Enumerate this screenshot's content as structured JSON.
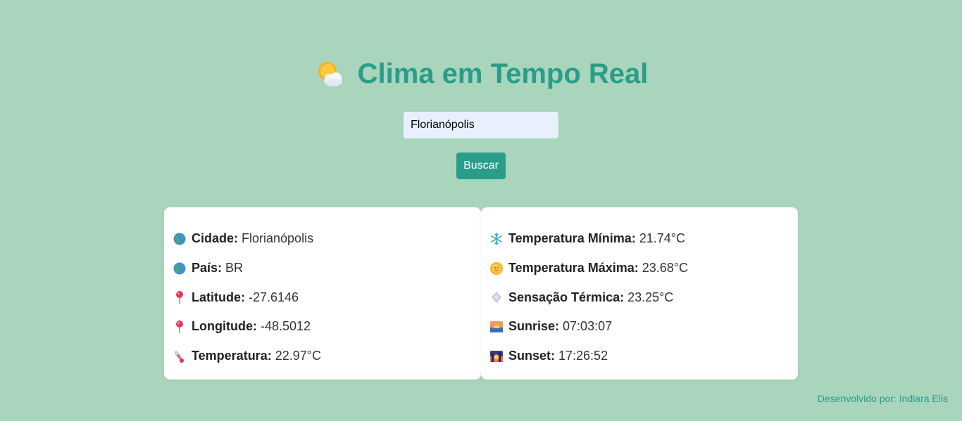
{
  "header": {
    "icon": "sun-behind-cloud-icon",
    "title": "Clima em Tempo Real"
  },
  "search": {
    "value": "Florianópolis",
    "button_label": "Buscar"
  },
  "left_card": [
    {
      "icon": "globe-icon",
      "label": "Cidade:",
      "value": "Florianópolis"
    },
    {
      "icon": "globe-icon",
      "label": "País:",
      "value": "BR"
    },
    {
      "icon": "pushpin-icon",
      "label": "Latitude:",
      "value": "-27.6146"
    },
    {
      "icon": "pushpin-icon",
      "label": "Longitude:",
      "value": "-48.5012"
    },
    {
      "icon": "thermometer-icon",
      "label": "Temperatura:",
      "value": "22.97°C"
    }
  ],
  "right_card": [
    {
      "icon": "snowflake-icon",
      "label": "Temperatura Mínima:",
      "value": "21.74°C"
    },
    {
      "icon": "sun-face-icon",
      "label": "Temperatura Máxima:",
      "value": "23.68°C"
    },
    {
      "icon": "wind-icon",
      "label": "Sensação Térmica:",
      "value": "23.25°C"
    },
    {
      "icon": "sunrise-icon",
      "label": "Sunrise:",
      "value": "07:03:07"
    },
    {
      "icon": "sunset-icon",
      "label": "Sunset:",
      "value": "17:26:52"
    }
  ],
  "footer": {
    "text": "Desenvolvido por: Indiara Elis"
  },
  "colors": {
    "background": "#a8d5bc",
    "accent": "#2a9d8a",
    "input_background": "#e8f0fe"
  }
}
